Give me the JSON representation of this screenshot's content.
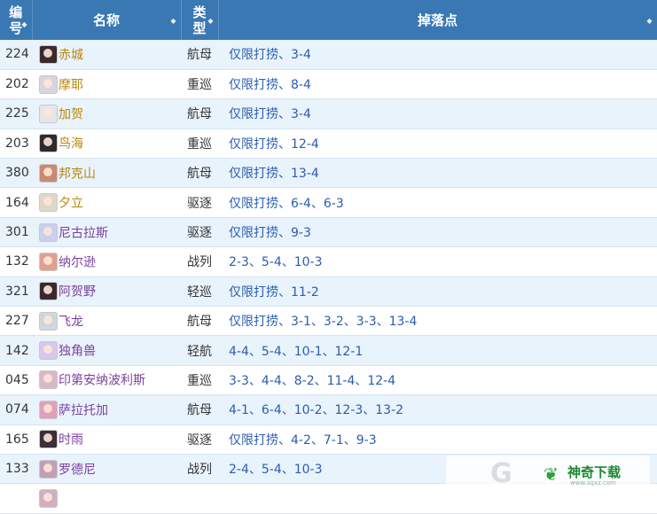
{
  "header": {
    "num": "编号",
    "name": "名称",
    "type": "类型",
    "drop": "掉落点"
  },
  "rows": [
    {
      "num": "224",
      "name": "赤城",
      "type": "航母",
      "drop": "仅限打捞、3-4",
      "name_color": "#b8860b",
      "avatar": "#3a2a2a"
    },
    {
      "num": "202",
      "name": "摩耶",
      "type": "重巡",
      "drop": "仅限打捞、8-4",
      "name_color": "#b8860b",
      "avatar": "#d8d4e0"
    },
    {
      "num": "225",
      "name": "加贺",
      "type": "航母",
      "drop": "仅限打捞、3-4",
      "name_color": "#b8860b",
      "avatar": "#e6e6ea"
    },
    {
      "num": "203",
      "name": "鸟海",
      "type": "重巡",
      "drop": "仅限打捞、12-4",
      "name_color": "#b8860b",
      "avatar": "#2e2a2e"
    },
    {
      "num": "380",
      "name": "邦克山",
      "type": "航母",
      "drop": "仅限打捞、13-4",
      "name_color": "#b8860b",
      "avatar": "#c98a70"
    },
    {
      "num": "164",
      "name": "夕立",
      "type": "驱逐",
      "drop": "仅限打捞、6-4、6-3",
      "name_color": "#b8860b",
      "avatar": "#ddd8c8"
    },
    {
      "num": "301",
      "name": "尼古拉斯",
      "type": "驱逐",
      "drop": "仅限打捞、9-3",
      "name_color": "#7b3fa0",
      "avatar": "#c8d0ec"
    },
    {
      "num": "132",
      "name": "纳尔逊",
      "type": "战列",
      "drop": "2-3、5-4、10-3",
      "name_color": "#7b3fa0",
      "avatar": "#e0a090"
    },
    {
      "num": "321",
      "name": "阿贺野",
      "type": "轻巡",
      "drop": "仅限打捞、11-2",
      "name_color": "#7b3fa0",
      "avatar": "#3a2830"
    },
    {
      "num": "227",
      "name": "飞龙",
      "type": "航母",
      "drop": "仅限打捞、3-1、3-2、3-3、13-4",
      "name_color": "#7b3fa0",
      "avatar": "#d0d6de"
    },
    {
      "num": "142",
      "name": "独角兽",
      "type": "轻航",
      "drop": "4-4、5-4、10-1、12-1",
      "name_color": "#7b3fa0",
      "avatar": "#d6c8ec"
    },
    {
      "num": "045",
      "name": "印第安纳波利斯",
      "type": "重巡",
      "drop": "3-3、4-4、8-2、11-4、12-4",
      "name_color": "#7b3fa0",
      "avatar": "#d8b8c8"
    },
    {
      "num": "074",
      "name": "萨拉托加",
      "type": "航母",
      "drop": "4-1、6-4、10-2、12-3、13-2",
      "name_color": "#7b3fa0",
      "avatar": "#e0a0b8"
    },
    {
      "num": "165",
      "name": "时雨",
      "type": "驱逐",
      "drop": "仅限打捞、4-2、7-1、9-3",
      "name_color": "#7b3fa0",
      "avatar": "#3a3038"
    },
    {
      "num": "133",
      "name": "罗德尼",
      "type": "战列",
      "drop": "2-4、5-4、10-3",
      "name_color": "#7b3fa0",
      "avatar": "#c0a0b8"
    },
    {
      "num": "",
      "name": "",
      "type": "",
      "drop": "",
      "name_color": "#7b3fa0",
      "avatar": "#d0b0c0"
    }
  ],
  "watermark": {
    "text": "神奇下载",
    "sub": "www.sqxz.com",
    "color": "#1f8a31"
  }
}
